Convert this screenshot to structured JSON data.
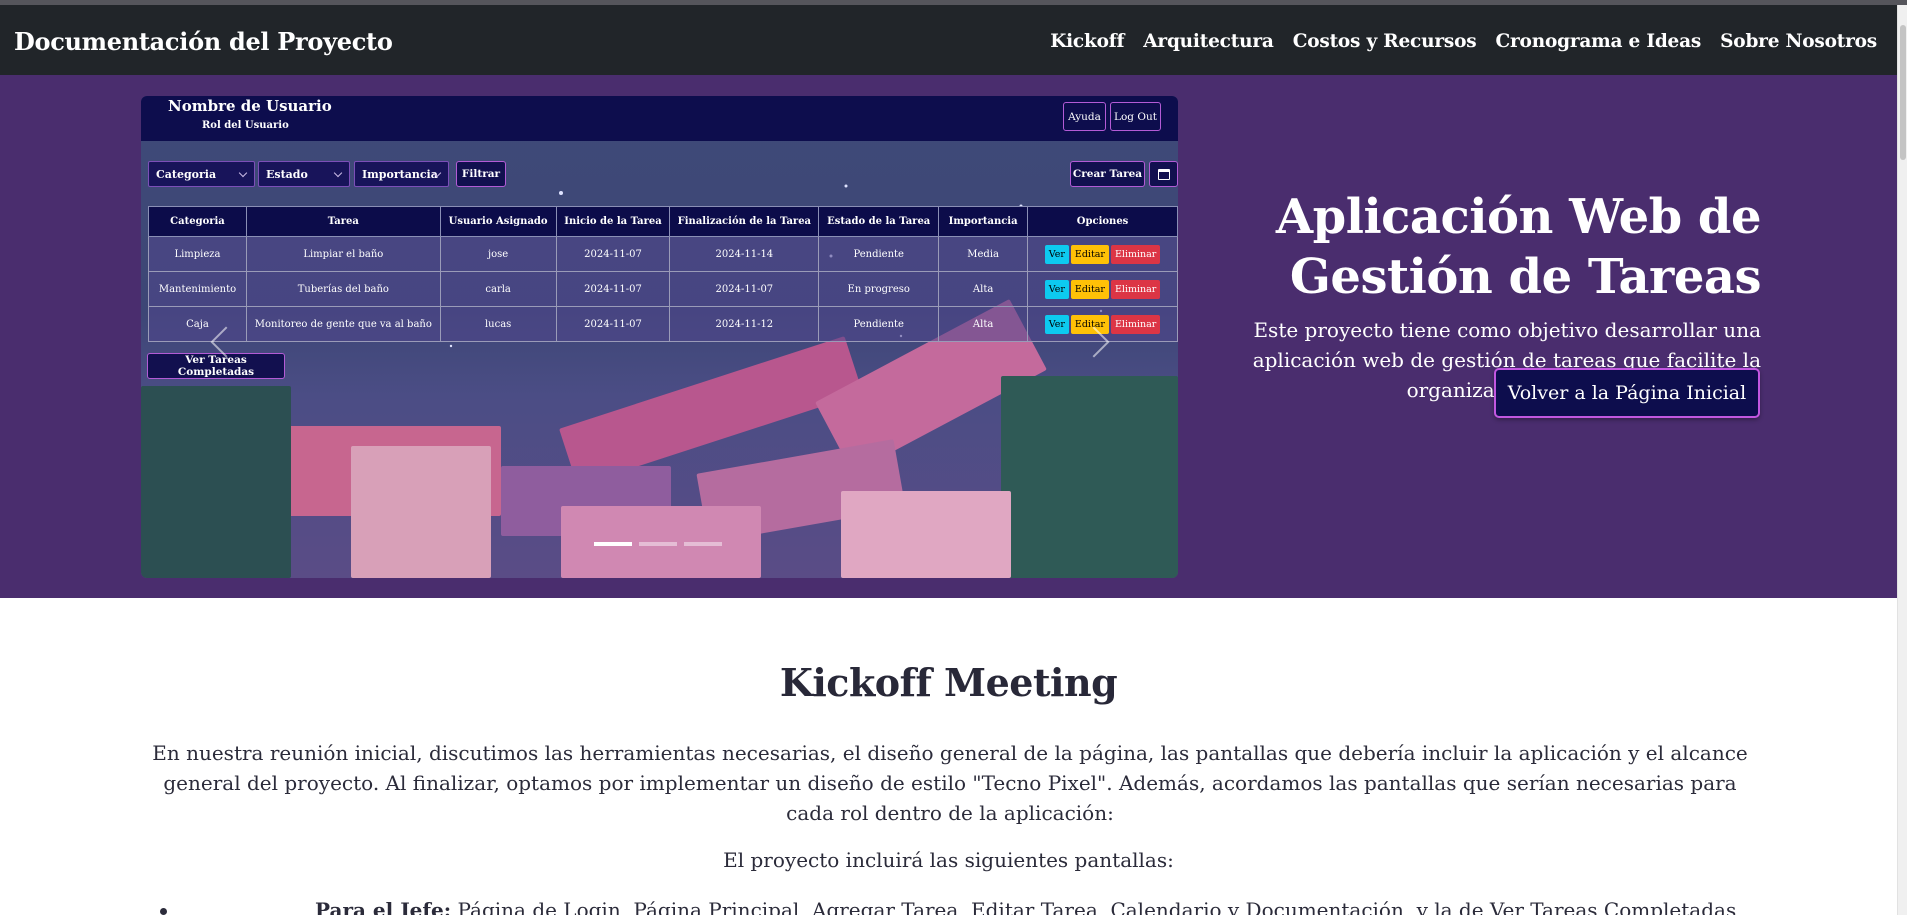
{
  "navbar": {
    "brand": "Documentación del Proyecto",
    "links": [
      "Kickoff",
      "Arquitectura",
      "Costos y Recursos",
      "Cronograma e Ideas",
      "Sobre Nosotros"
    ]
  },
  "app_preview": {
    "user_name": "Nombre de Usuario",
    "user_role": "Rol del Usuario",
    "help_label": "Ayuda",
    "logout_label": "Log Out",
    "filters": [
      "Categoria",
      "Estado",
      "Importancia"
    ],
    "filter_button": "Filtrar",
    "create_task": "Crear Tarea",
    "completed_button": "Ver Tareas Completadas",
    "table": {
      "headers": [
        "Categoria",
        "Tarea",
        "Usuario Asignado",
        "Inicio de la Tarea",
        "Finalización de la Tarea",
        "Estado de la Tarea",
        "Importancia",
        "Opciones"
      ],
      "rows": [
        [
          "Limpieza",
          "Limpiar el baño",
          "jose",
          "2024-11-07",
          "2024-11-14",
          "Pendiente",
          "Media"
        ],
        [
          "Mantenimiento",
          "Tuberías del baño",
          "carla",
          "2024-11-07",
          "2024-11-07",
          "En progreso",
          "Alta"
        ],
        [
          "Caja",
          "Monitoreo de gente que va al baño",
          "lucas",
          "2024-11-07",
          "2024-11-12",
          "Pendiente",
          "Alta"
        ]
      ],
      "option_labels": {
        "view": "Ver",
        "edit": "Editar",
        "delete": "Eliminar"
      }
    },
    "carousel_active_slide": 1,
    "carousel_slide_count": 3
  },
  "hero": {
    "title": "Aplicación Web de Gestión de Tareas",
    "text": "Este proyecto tiene como objetivo desarrollar una aplicación web de gestión de tareas que facilite la organización personal y de equipo.",
    "cta": "Volver a la Página Inicial"
  },
  "kickoff": {
    "title": "Kickoff Meeting",
    "paragraph": "En nuestra reunión inicial, discutimos las herramientas necesarias, el diseño general de la página, las pantallas que debería incluir la aplicación y el alcance general del proyecto. Al finalizar, optamos por implementar un diseño de estilo \"Tecno Pixel\". Además, acordamos las pantallas que serían necesarias para cada rol dentro de la aplicación:",
    "screens_intro": "El proyecto incluirá las siguientes pantallas:",
    "items": [
      {
        "role": "Para el Jefe:",
        "screens": "Página de Login, Página Principal, Agregar Tarea, Editar Tarea, Calendario y Documentación, y la de Ver Tareas Completadas"
      }
    ]
  },
  "colors": {
    "navbar": "#212529",
    "hero_bg": "#4a2d6e",
    "app_header": "#0d0d4d",
    "accent_border": "#b35bd6"
  }
}
